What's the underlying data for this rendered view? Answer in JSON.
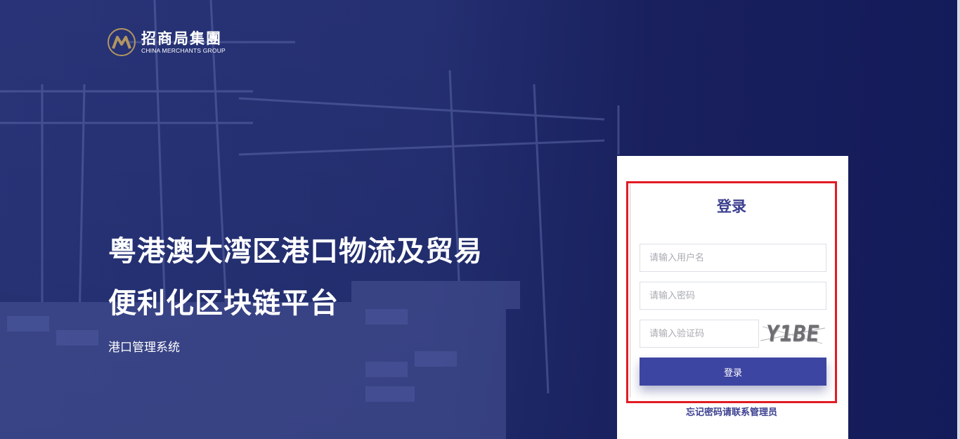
{
  "brand": {
    "name_cn": "招商局集團",
    "name_en": "CHINA MERCHANTS GROUP",
    "logo_icon": "china-merchants-logo-icon",
    "accent": "#b29561"
  },
  "hero": {
    "line1": "粤港澳大湾区港口物流及贸易",
    "line2": "便利化区块链平台",
    "subtitle": "港口管理系统"
  },
  "login": {
    "title": "登录",
    "username_placeholder": "请输入用户名",
    "password_placeholder": "请输入密码",
    "captcha_placeholder": "请输入验证码",
    "captcha_text": "Y1BE",
    "submit_label": "登录",
    "forgot_text": "忘记密码请联系管理员"
  },
  "colors": {
    "primary": "#3d45a2",
    "highlight_border": "#e31b23",
    "background": "#1b2460"
  }
}
